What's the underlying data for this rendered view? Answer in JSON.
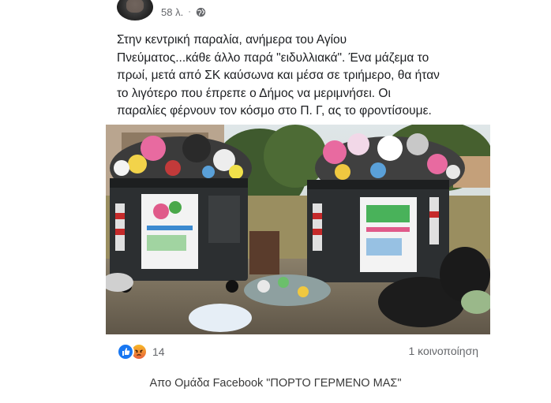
{
  "post": {
    "timestamp": "58 λ.",
    "separator": "·",
    "privacy_icon": "globe-icon",
    "text": "Στην κεντρική παραλία, ανήμερα του Αγίου\nΠνεύματος...κάθε άλλο παρά \"ειδυλλιακά\". Ένα μάζεμα το\nπρωί, μετά από ΣΚ καύσωνα και μέσα σε τριήμερο, θα ήταν\nτο λιγότερο που έπρεπε ο Δήμος να μεριμνήσει. Οι\nπαραλίες φέρνουν τον κόσμο στο Π. Γ, ας το φροντίσουμε.",
    "photo_icon": "overflowing-dumpsters-photo",
    "reactions": {
      "icons": [
        "like-icon",
        "angry-icon"
      ],
      "count": "14"
    },
    "shares": "1 κοινοποίηση"
  },
  "caption": "Απο Ομάδα Facebook \"ΠΟΡΤΟ ΓΕΡΜΕΝΟ ΜΑΣ\"",
  "colors": {
    "like": "#1877f2",
    "angry": "#e8613c",
    "secondary_text": "#65676b"
  }
}
